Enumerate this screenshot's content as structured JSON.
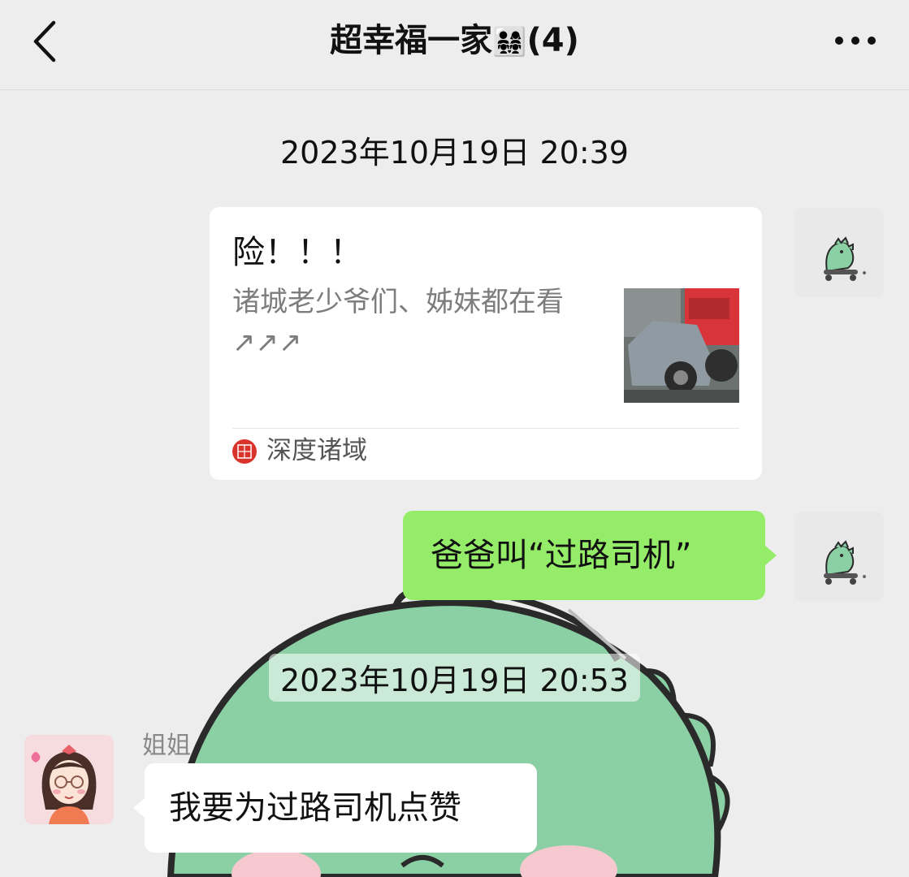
{
  "header": {
    "title": "超幸福一家",
    "title_emoji": "👨‍👩‍👧‍👧",
    "member_count": "(4)",
    "back_icon": "chevron-left-icon",
    "more_icon": "more-dots-icon"
  },
  "chat": {
    "timestamps": [
      "2023年10月19日 20:39",
      "2023年10月19日 20:53"
    ],
    "link_card": {
      "title": "险！！！",
      "description": "诸城老少爷们、姊妹都在看↗↗↗",
      "source": "深度诸域"
    },
    "outgoing_message": "爸爸叫“过路司机”",
    "incoming": {
      "sender": "姐姐",
      "message": "我要为过路司机点赞"
    }
  },
  "colors": {
    "background": "#ededed",
    "outgoing_bubble": "#95ec69",
    "incoming_bubble": "#ffffff",
    "sticker_green": "#8bcfa4",
    "source_icon_red": "#d9342b"
  }
}
